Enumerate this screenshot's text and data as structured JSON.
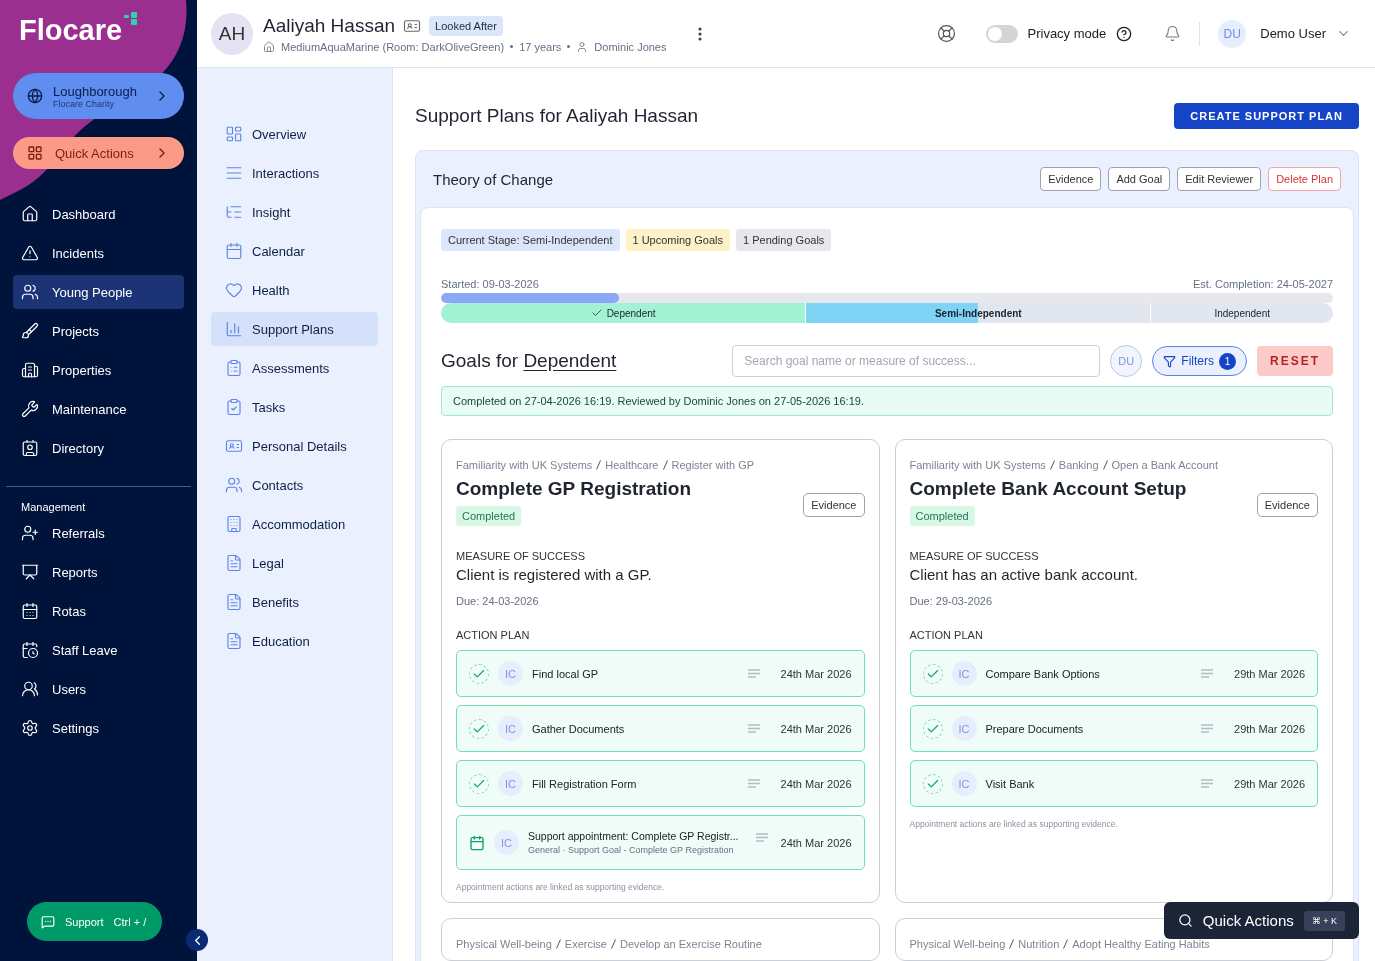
{
  "sidebar": {
    "logo": "Flocare",
    "org": {
      "name": "Loughborough",
      "sub": "Flocare Charity"
    },
    "quick_actions": "Quick Actions",
    "items": [
      {
        "label": "Dashboard",
        "selected": false
      },
      {
        "label": "Incidents",
        "selected": false
      },
      {
        "label": "Young People",
        "selected": true
      },
      {
        "label": "Projects",
        "selected": false
      },
      {
        "label": "Properties",
        "selected": false
      },
      {
        "label": "Maintenance",
        "selected": false
      },
      {
        "label": "Directory",
        "selected": false
      }
    ],
    "section": "Management",
    "management": [
      {
        "label": "Referrals",
        "selected": false
      },
      {
        "label": "Reports",
        "selected": false
      },
      {
        "label": "Rotas",
        "selected": false
      },
      {
        "label": "Staff Leave",
        "selected": false
      },
      {
        "label": "Users",
        "selected": false
      },
      {
        "label": "Settings",
        "selected": false
      }
    ],
    "support": {
      "label": "Support",
      "shortcut": "Ctrl + /"
    }
  },
  "header": {
    "initials": "AH",
    "name": "Aaliyah Hassan",
    "badge": "Looked After",
    "location": "MediumAquaMarine (Room: DarkOliveGreen)",
    "age": "17 years",
    "worker": "Dominic Jones",
    "privacy": {
      "label": "Privacy mode",
      "on": false
    },
    "user": {
      "initials": "DU",
      "name": "Demo User"
    }
  },
  "subnav": [
    {
      "label": "Overview",
      "selected": false
    },
    {
      "label": "Interactions",
      "selected": false
    },
    {
      "label": "Insight",
      "selected": false
    },
    {
      "label": "Calendar",
      "selected": false
    },
    {
      "label": "Health",
      "selected": false
    },
    {
      "label": "Support Plans",
      "selected": true
    },
    {
      "label": "Assessments",
      "selected": false
    },
    {
      "label": "Tasks",
      "selected": false
    },
    {
      "label": "Personal Details",
      "selected": false
    },
    {
      "label": "Contacts",
      "selected": false
    },
    {
      "label": "Accommodation",
      "selected": false
    },
    {
      "label": "Legal",
      "selected": false
    },
    {
      "label": "Benefits",
      "selected": false
    },
    {
      "label": "Education",
      "selected": false
    }
  ],
  "page": {
    "title": "Support Plans for Aaliyah Hassan",
    "create_button": "CREATE SUPPORT PLAN"
  },
  "plan": {
    "title": "Theory of Change",
    "buttons": [
      {
        "label": "Evidence",
        "kind": "normal"
      },
      {
        "label": "Add Goal",
        "kind": "normal"
      },
      {
        "label": "Edit Reviewer",
        "kind": "normal"
      },
      {
        "label": "Delete Plan",
        "kind": "danger"
      }
    ],
    "tags": [
      {
        "label": "Current Stage: Semi-Independent",
        "color": "#dbe6fb"
      },
      {
        "label": "1 Upcoming Goals",
        "color": "#fdf1c8"
      },
      {
        "label": "1 Pending Goals",
        "color": "#e6e8ec"
      }
    ],
    "started": "Started: 09-03-2026",
    "est_completion": "Est. Completion: 24-05-2027",
    "level": 0.2,
    "stages": [
      {
        "label": "Dependent",
        "completed": true,
        "current": false
      },
      {
        "label": "Semi-Independent",
        "completed": false,
        "current": true,
        "level": 0.5
      },
      {
        "label": "Independent",
        "completed": false,
        "current": false
      }
    ],
    "goals_heading": "Goals for ",
    "goals_stage": "Dependent",
    "search": {
      "placeholder": "Search goal name or measure of success..."
    },
    "reviewer": "DU",
    "filters": {
      "label": "Filters",
      "count": "1"
    },
    "reset": "RESET",
    "completion": "Completed on 27-04-2026 16:19. Reviewed by Dominic Jones on 27-05-2026 16:19.",
    "goals": [
      {
        "path": [
          "Familiarity with UK Systems",
          "Healthcare",
          "Register with GP"
        ],
        "title": "Complete GP Registration",
        "status": "Completed",
        "evidence": "Evidence",
        "measure_label": "MEASURE OF SUCCESS",
        "measure": "Client is registered with a GP.",
        "due": "Due: 24-03-2026",
        "action_label": "ACTION PLAN",
        "actions": [
          {
            "kind": "task",
            "done": true,
            "initials": "IC",
            "title": "Find local GP",
            "date": "24th Mar 2026"
          },
          {
            "kind": "task",
            "done": true,
            "initials": "IC",
            "title": "Gather Documents",
            "date": "24th Mar 2026"
          },
          {
            "kind": "task",
            "done": true,
            "initials": "IC",
            "title": "Fill Registration Form",
            "date": "24th Mar 2026"
          },
          {
            "kind": "appointment",
            "initials": "IC",
            "title": "Support appointment: Complete GP Registr...",
            "subtitle": "General · Support Goal - Complete GP Registration",
            "date": "24th Mar 2026"
          }
        ],
        "note": "Appointment actions are linked as supporting evidence."
      },
      {
        "path": [
          "Familiarity with UK Systems",
          "Banking",
          "Open a Bank Account"
        ],
        "title": "Complete Bank Account Setup",
        "status": "Completed",
        "evidence": "Evidence",
        "measure_label": "MEASURE OF SUCCESS",
        "measure": "Client has an active bank account.",
        "due": "Due: 29-03-2026",
        "action_label": "ACTION PLAN",
        "actions": [
          {
            "kind": "task",
            "done": true,
            "initials": "IC",
            "title": "Compare Bank Options",
            "date": "29th Mar 2026"
          },
          {
            "kind": "task",
            "done": true,
            "initials": "IC",
            "title": "Prepare Documents",
            "date": "29th Mar 2026"
          },
          {
            "kind": "task",
            "done": true,
            "initials": "IC",
            "title": "Visit Bank",
            "date": "29th Mar 2026"
          }
        ],
        "note": "Appointment actions are linked as supporting evidence."
      },
      {
        "path": [
          "Physical Well-being",
          "Exercise",
          "Develop an Exercise Routine"
        ]
      },
      {
        "path": [
          "Physical Well-being",
          "Nutrition",
          "Adopt Healthy Eating Habits"
        ]
      }
    ]
  },
  "quick_actions": {
    "label": "Quick Actions",
    "shortcut": "⌘ + K"
  }
}
